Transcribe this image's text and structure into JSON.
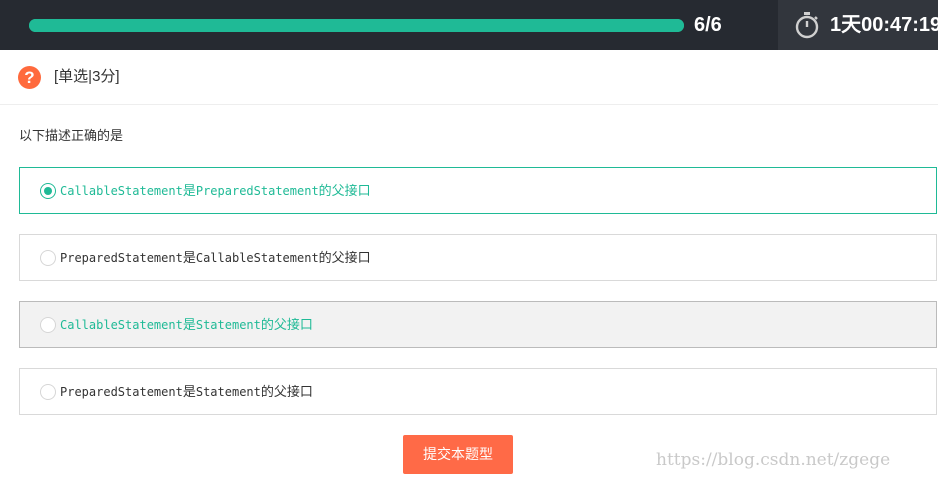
{
  "progress": {
    "text": "6/6",
    "fraction": 1.0,
    "color": "#1fba96"
  },
  "timer": {
    "icon": "stopwatch-icon",
    "text": "1天00:47:19"
  },
  "question": {
    "type_label": "[单选|3分]",
    "icon": "question-icon",
    "stem": "以下描述正确的是",
    "options": [
      {
        "code": "CallableStatement",
        "mid": "是",
        "code2": "PreparedStatement",
        "tail": "的父接口",
        "selected": true
      },
      {
        "code": "PreparedStatement",
        "mid": "是",
        "code2": "CallableStatement",
        "tail": "的父接口",
        "selected": false
      },
      {
        "code": "CallableStatement",
        "mid": "是",
        "code2": "Statement",
        "tail": "的父接口",
        "selected": false,
        "hovered": true
      },
      {
        "code": "PreparedStatement",
        "mid": "是",
        "code2": "Statement",
        "tail": "的父接口",
        "selected": false
      }
    ]
  },
  "submit_label": "提交本题型",
  "watermark": "https://blog.csdn.net/zgege",
  "colors": {
    "accent": "#1fba96",
    "submit": "#ff6a47",
    "topbar": "#262a31"
  }
}
